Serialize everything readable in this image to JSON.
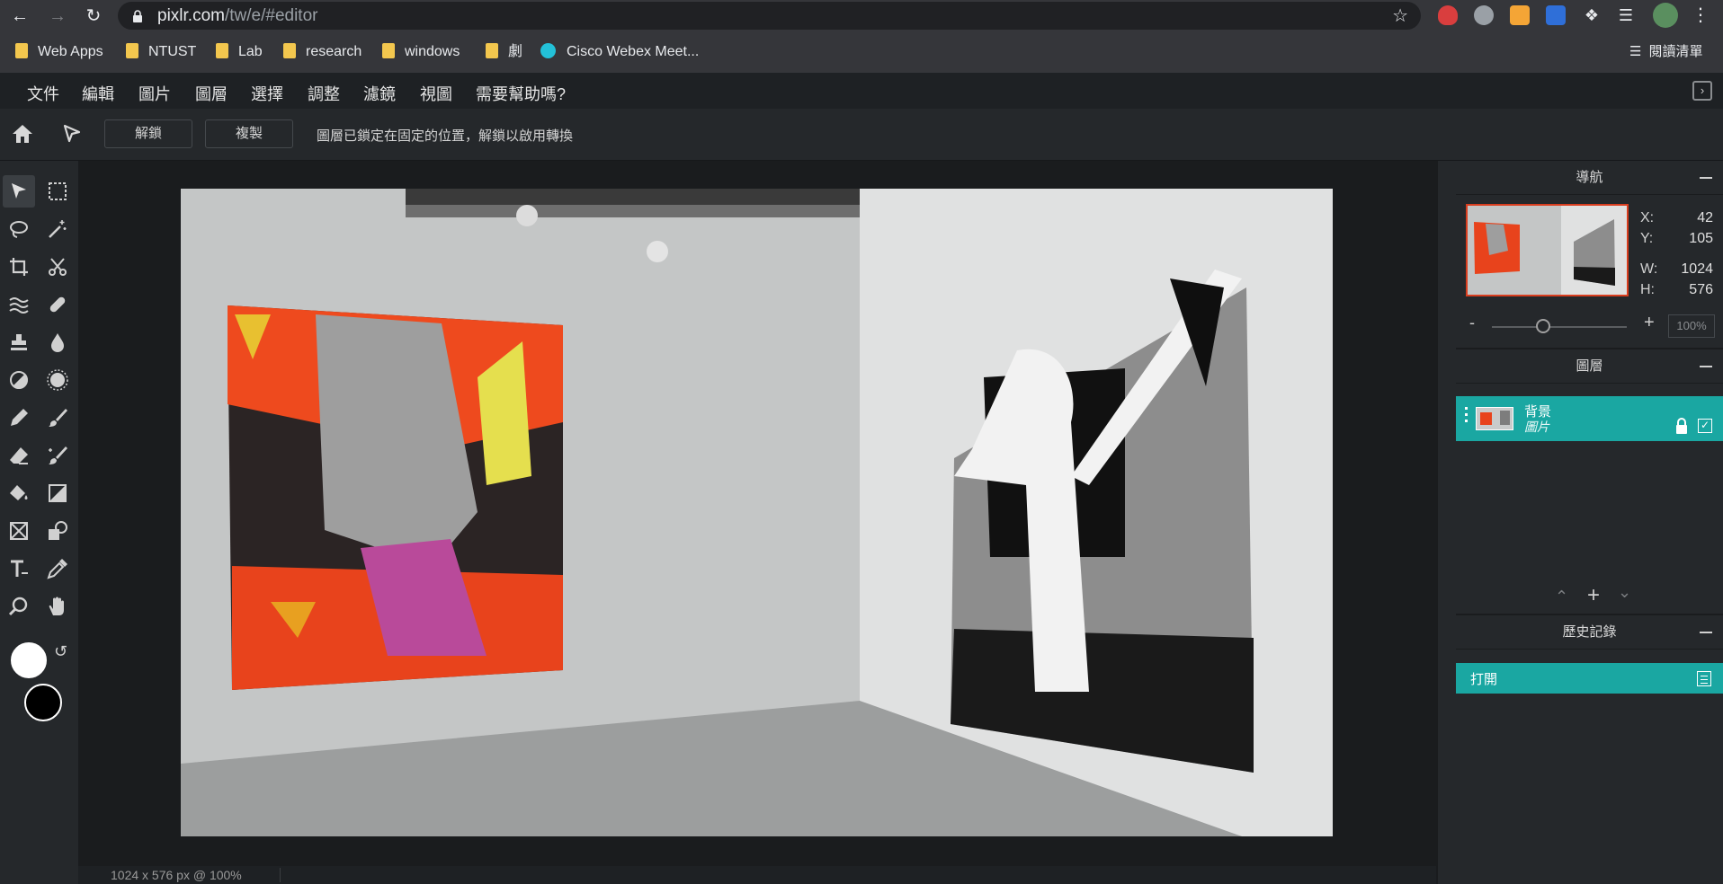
{
  "browser": {
    "url_host": "pixlr.com",
    "url_path": "/tw/e/#editor",
    "bookmarks": [
      "Web Apps",
      "NTUST",
      "Lab",
      "research",
      "windows",
      "劇",
      "Cisco Webex Meet..."
    ],
    "reading_list": "閱讀清單"
  },
  "menu": [
    "文件",
    "編輯",
    "圖片",
    "圖層",
    "選擇",
    "調整",
    "濾鏡",
    "視圖",
    "需要幫助嗎?"
  ],
  "options": {
    "unlock_label": "解鎖",
    "duplicate_label": "複製",
    "lock_message": "圖層已鎖定在固定的位置，解鎖以啟用轉換"
  },
  "navigator": {
    "title": "導航",
    "x_label": "X:",
    "x": "42",
    "y_label": "Y:",
    "y": "105",
    "w_label": "W:",
    "w": "1024",
    "h_label": "H:",
    "h": "576",
    "zoom": "100%",
    "zoom_level": 0.38
  },
  "layers": {
    "title": "圖層",
    "items": [
      {
        "name": "背景",
        "type": "圖片"
      }
    ]
  },
  "history": {
    "title": "歷史記錄",
    "items": [
      "打開"
    ]
  },
  "status": {
    "text": "1024 x 576 px @ 100%"
  },
  "colors": {
    "accent": "#1aa7a2",
    "foreground": "#ffffff",
    "background": "#000000"
  }
}
